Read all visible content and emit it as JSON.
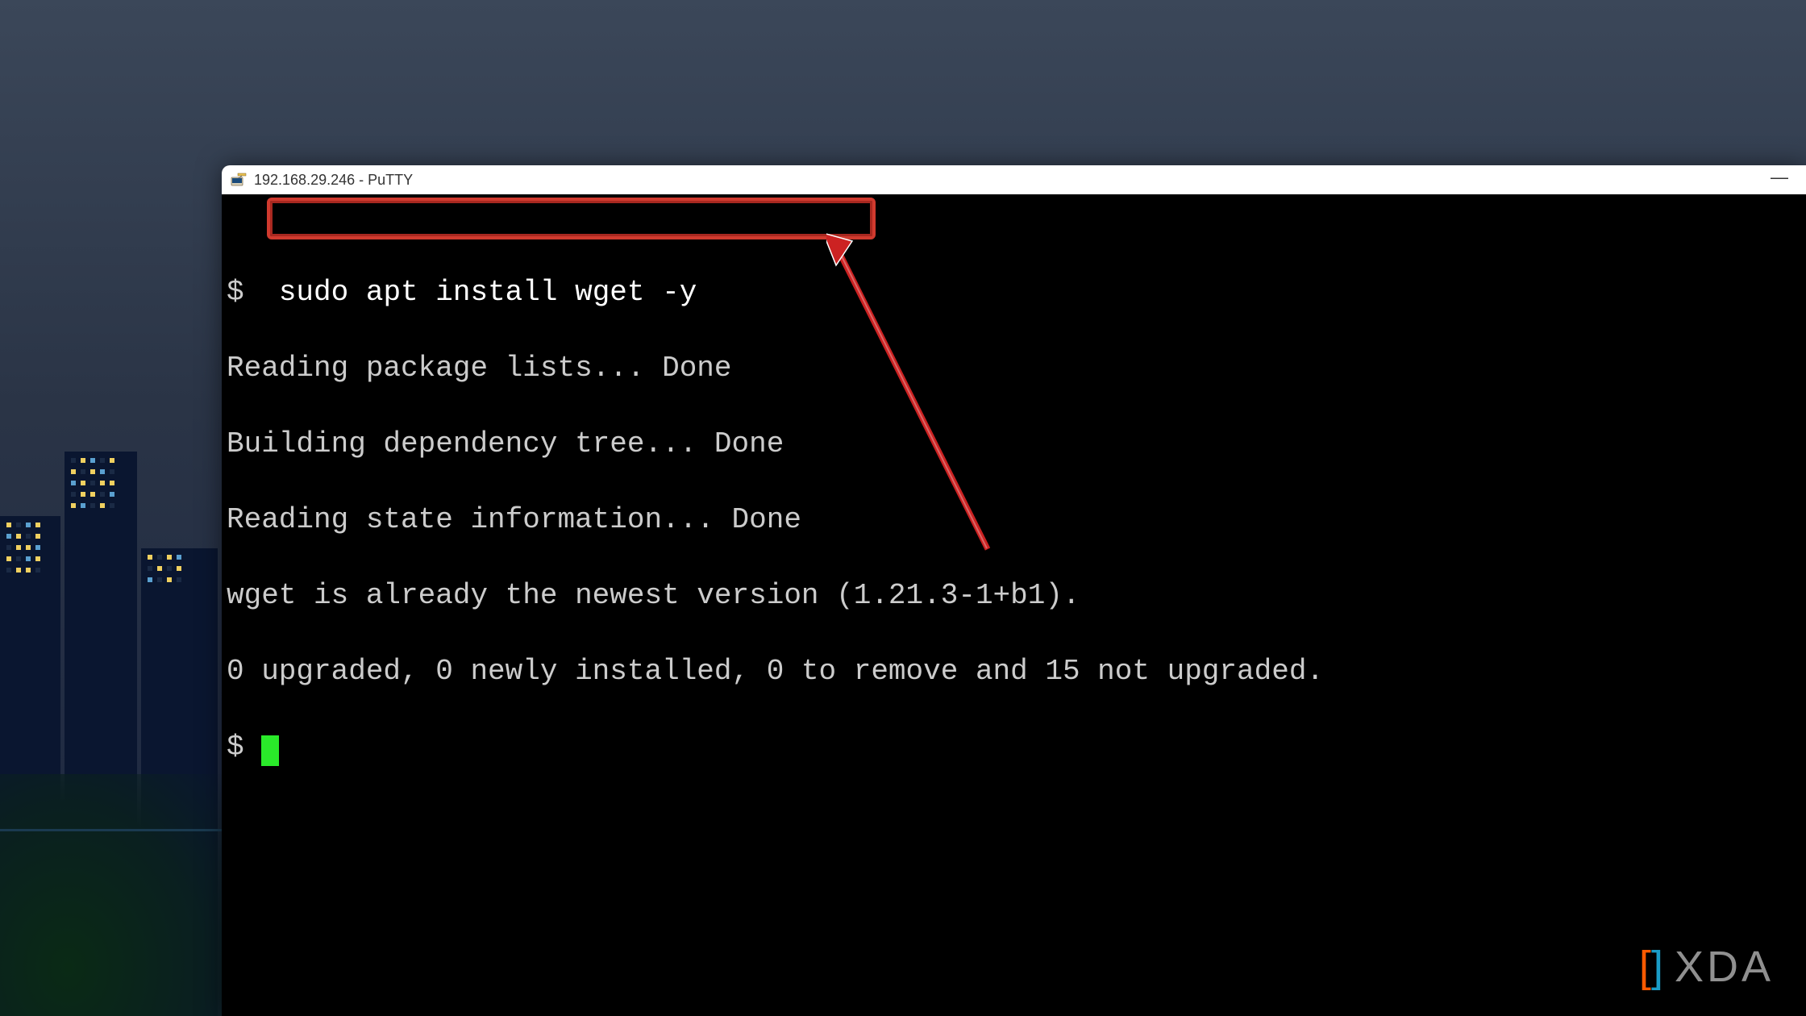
{
  "window": {
    "title": "192.168.29.246 - PuTTY"
  },
  "terminal": {
    "prompt": "$",
    "command": "sudo apt install wget -y",
    "lines": [
      "Reading package lists... Done",
      "Building dependency tree... Done",
      "Reading state information... Done",
      "wget is already the newest version (1.21.3-1+b1).",
      "0 upgraded, 0 newly installed, 0 to remove and 15 not upgraded."
    ]
  },
  "watermark": {
    "text": "XDA"
  }
}
